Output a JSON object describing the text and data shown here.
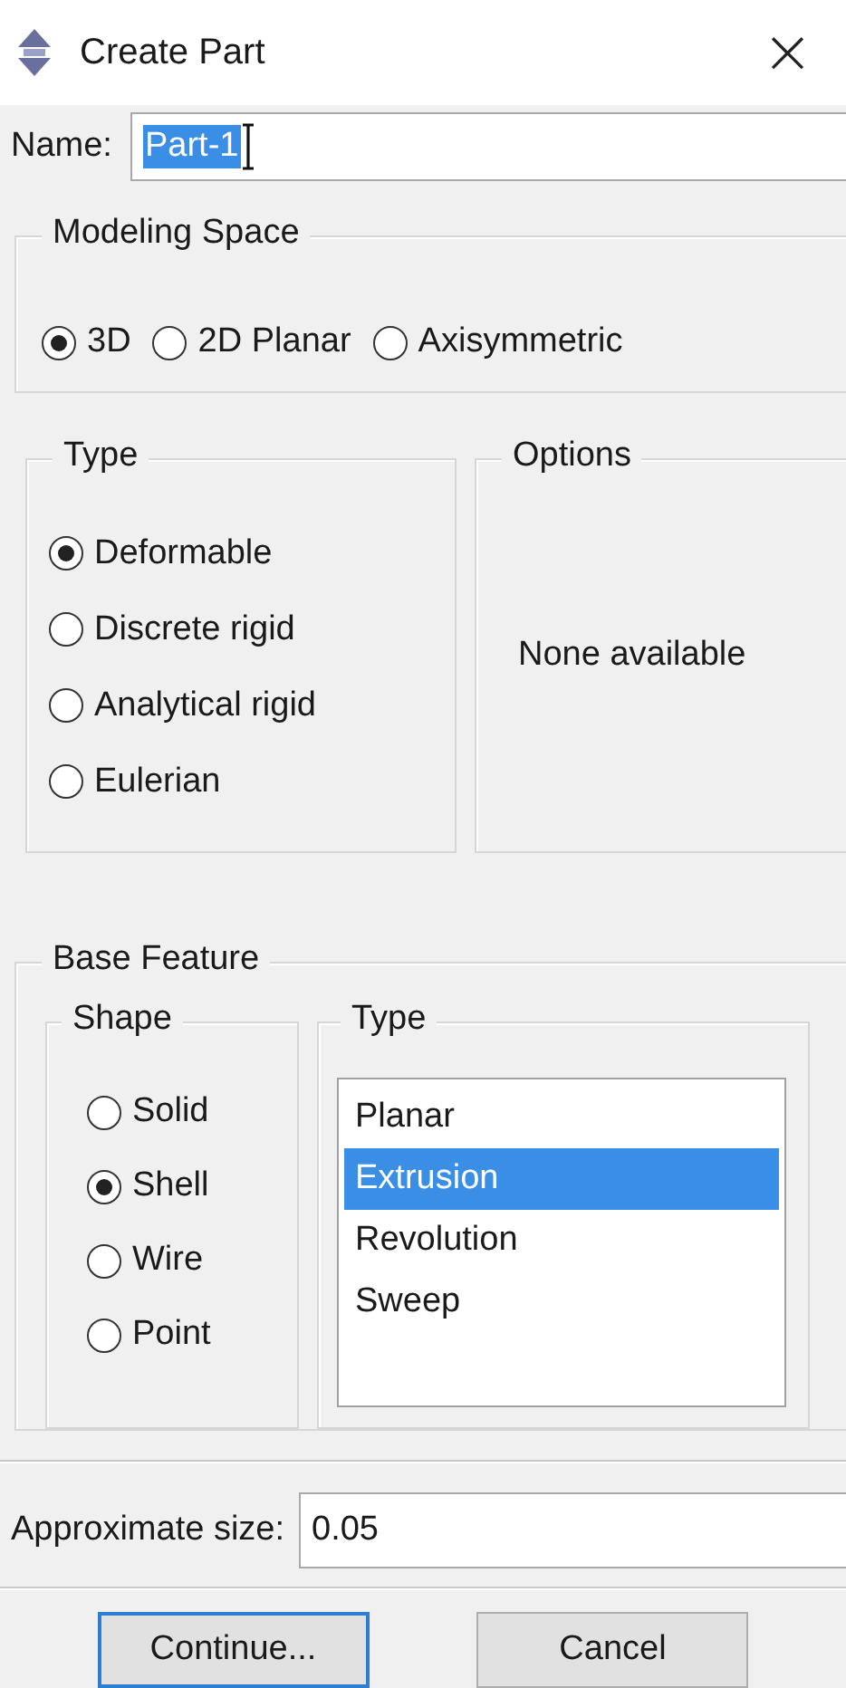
{
  "window": {
    "title": "Create Part",
    "close": "×"
  },
  "name": {
    "label": "Name:",
    "value": "Part-1",
    "value_selected": true
  },
  "modeling_space": {
    "title": "Modeling Space",
    "options": [
      {
        "label": "3D",
        "selected": true
      },
      {
        "label": "2D Planar",
        "selected": false
      },
      {
        "label": "Axisymmetric",
        "selected": false
      }
    ]
  },
  "type": {
    "title": "Type",
    "options": [
      {
        "label": "Deformable",
        "selected": true
      },
      {
        "label": "Discrete rigid",
        "selected": false
      },
      {
        "label": "Analytical rigid",
        "selected": false
      },
      {
        "label": "Eulerian",
        "selected": false
      }
    ]
  },
  "options": {
    "title": "Options",
    "message": "None available"
  },
  "base_feature": {
    "title": "Base Feature",
    "shape": {
      "title": "Shape",
      "options": [
        {
          "label": "Solid",
          "selected": false
        },
        {
          "label": "Shell",
          "selected": true
        },
        {
          "label": "Wire",
          "selected": false
        },
        {
          "label": "Point",
          "selected": false
        }
      ]
    },
    "type": {
      "title": "Type",
      "items": [
        {
          "label": "Planar",
          "selected": false
        },
        {
          "label": "Extrusion",
          "selected": true
        },
        {
          "label": "Revolution",
          "selected": false
        },
        {
          "label": "Sweep",
          "selected": false
        }
      ]
    }
  },
  "approximate_size": {
    "label": "Approximate size:",
    "value": "0.05"
  },
  "buttons": [
    {
      "label": "Continue...",
      "default": true
    },
    {
      "label": "Cancel",
      "default": false
    }
  ]
}
